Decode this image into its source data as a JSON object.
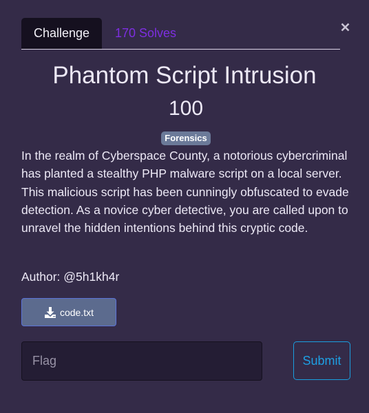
{
  "tabs": {
    "challenge_label": "Challenge",
    "solves_label": "170 Solves"
  },
  "challenge": {
    "title": "Phantom Script Intrusion",
    "points": "100",
    "category": "Forensics",
    "description": "In the realm of Cyberspace County, a notorious cybercriminal has planted a stealthy PHP malware script on a local server. This malicious script has been cunningly obfuscated to evade detection. As a novice cyber detective, you are called upon to unravel the hidden intentions behind this cryptic code.",
    "author": "Author: @5h1kh4r"
  },
  "files": [
    {
      "name": "code.txt",
      "icon": "download-icon"
    }
  ],
  "flag_form": {
    "placeholder": "Flag",
    "value": "",
    "submit_label": "Submit"
  },
  "icons": {
    "close": "close-icon",
    "download": "download-icon"
  },
  "colors": {
    "background": "#342b48",
    "active_tab": "#15101f",
    "solves_link": "#7d2ee0",
    "badge": "#6b7a99",
    "file_button": "#5c6b8e",
    "submit": "#1e9fe3"
  }
}
